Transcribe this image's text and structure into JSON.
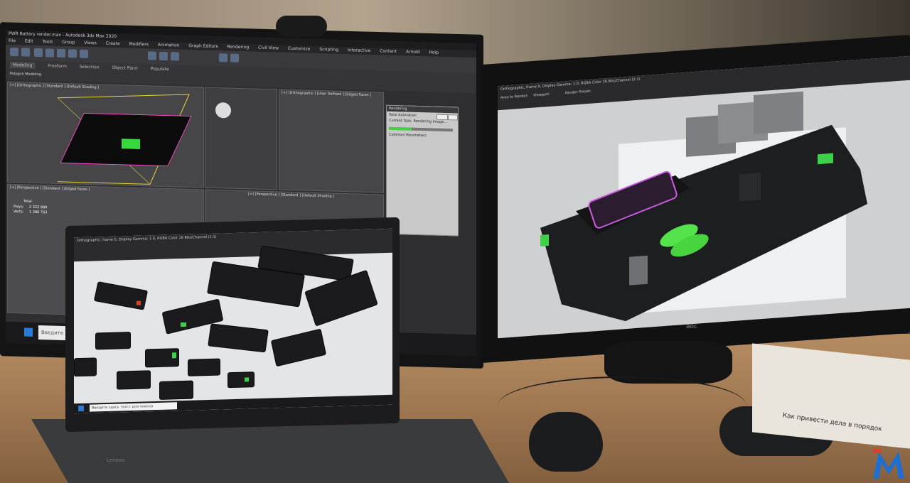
{
  "left_monitor": {
    "window_title": "PWR Battery render.max - Autodesk 3ds Max 2020",
    "menu": [
      "File",
      "Edit",
      "Tools",
      "Group",
      "Views",
      "Create",
      "Modifiers",
      "Animation",
      "Graph Editors",
      "Rendering",
      "Civil View",
      "Customize",
      "Scripting",
      "Interactive",
      "Content",
      "Arnold",
      "Help"
    ],
    "ribbon_tabs": [
      "Modeling",
      "Freeform",
      "Selection",
      "Object Paint",
      "Populate"
    ],
    "ribbon_subtitle": "Polygon Modeling",
    "viewports": [
      {
        "label": "[+] [Orthographic ] [Standard ] [Default Shading ]"
      },
      {
        "label": "[+] [Orthographic ] [User Defined ] [Edged Faces ]"
      },
      {
        "label": "[+] [Perspective ] [Standard ] [Edged Faces ]"
      },
      {
        "label": "[+] [Perspective ] [Standard ] [Default Shading ]"
      }
    ],
    "stats": {
      "total_label": "Total",
      "polys_label": "Polys:",
      "polys_value": "2 322 889",
      "verts_label": "Verts:",
      "verts_value": "1 386 763"
    },
    "render_dialog": {
      "title": "Rendering",
      "status": "Total Animation",
      "current_task_label": "Current Task:",
      "current_task": "Rendering Image...",
      "progress": 0.35,
      "section": "Common Parameters"
    },
    "taskbar_search": "Введите"
  },
  "right_monitor": {
    "window_title": "Orthographic, frame 0, Display Gamma: 1.0, RGBA Color 16 Bits/Channel (1:1)",
    "brand": "aoc",
    "labels": {
      "area_to_render": "Area to Render:",
      "viewport": "Viewport:",
      "render_preset": "Render Preset:"
    }
  },
  "laptop": {
    "window_title": "Orthographic, frame 0, Display Gamma: 1.0, RGBA Color 16 Bits/Channel (1:1)",
    "taskbar_search": "Введите здесь текст для поиска",
    "brand": "Lenovo"
  },
  "books": {
    "spine_text": "Как привести дела в порядок"
  },
  "colors": {
    "accent_green": "#3fd04a",
    "accent_red": "#d8432b",
    "max_bg": "#2f2f31",
    "render_bg": "#cfd0d2"
  }
}
